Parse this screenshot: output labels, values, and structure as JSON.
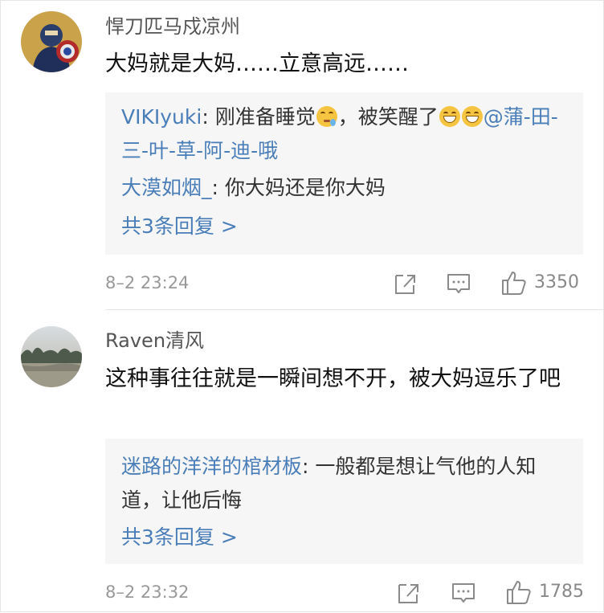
{
  "comments": [
    {
      "username": "悍刀匹马戍凉州",
      "text": "大妈就是大妈……立意高远……",
      "replies": [
        {
          "user": "VIKIyuki",
          "sep": ": ",
          "text_a": "刚准备睡觉",
          "text_b": "，被笑醒了",
          "mention": "@蒲-田-三-叶-草-阿-迪-哦"
        },
        {
          "user": "大漠如烟_",
          "sep": ": ",
          "text": "你大妈还是你大妈"
        }
      ],
      "more_replies": "共3条回复 >",
      "time": "8–2 23:24",
      "likes": "3350"
    },
    {
      "username": "Raven清风",
      "text": "这种事往往就是一瞬间想不开，被大妈逗乐了吧",
      "replies": [
        {
          "user": "迷路的洋洋的棺材板",
          "sep": ": ",
          "text": "一般都是想让气他的人知道，让他后悔"
        }
      ],
      "more_replies": "共3条回复 >",
      "time": "8–2 23:32",
      "likes": "1785"
    }
  ],
  "icons": {
    "share": "share-icon",
    "comment": "comment-icon",
    "like": "thumbs-up-icon"
  },
  "colors": {
    "link": "#4a7eb8",
    "reply_bg": "#f6f6f6",
    "meta": "#999999"
  }
}
